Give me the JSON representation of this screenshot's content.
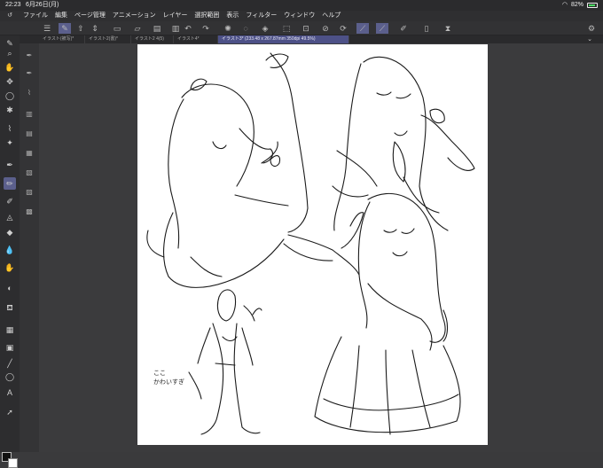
{
  "status": {
    "time": "22:23",
    "date": "6月26日(月)",
    "battery": "82%"
  },
  "menu": [
    "ファイル",
    "編集",
    "ページ管理",
    "アニメーション",
    "レイヤー",
    "選択範囲",
    "表示",
    "フィルター",
    "ウィンドウ",
    "ヘルプ"
  ],
  "tabs": [
    {
      "label": "イラスト(被写)*",
      "active": false
    },
    {
      "label": "イラスト2(書)*",
      "active": false
    },
    {
      "label": "イラスト2 4(5)",
      "active": false
    },
    {
      "label": "イラスト4*",
      "active": false
    },
    {
      "label": "イラスト3* (233.48 x 267.87mm 350dpi 49.5%)",
      "active": true
    }
  ],
  "canvas_note": [
    "ここ",
    "かわいすぎ"
  ],
  "colors": {
    "accent": "#5b5f8c",
    "main": "#111111",
    "sub": "#ffffff"
  }
}
